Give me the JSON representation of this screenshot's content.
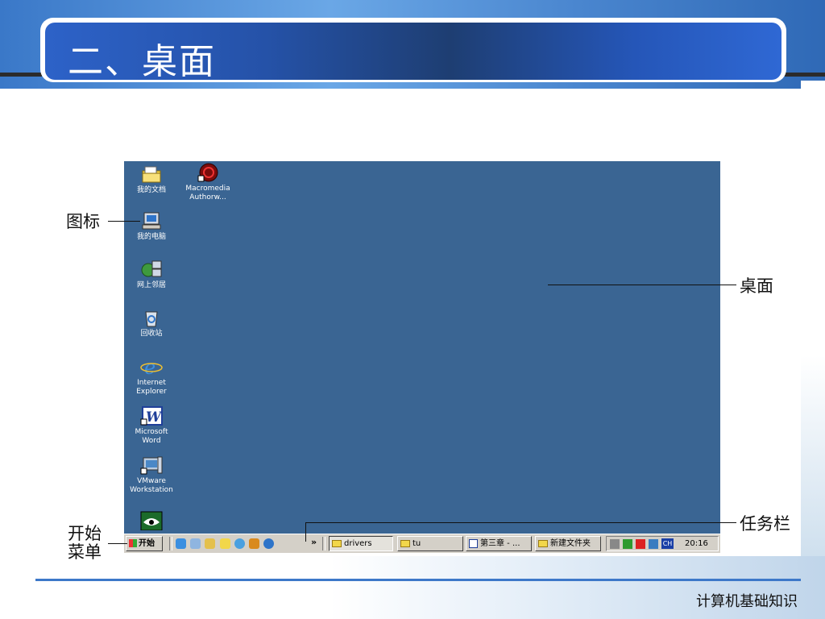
{
  "slide": {
    "title": "二、桌面",
    "footer": "计算机基础知识"
  },
  "annotations": {
    "icon_label": "图标",
    "desktop_label": "桌面",
    "taskbar_label": "任务栏",
    "start_menu_label_line1": "开始",
    "start_menu_label_line2": "菜单"
  },
  "desktop": {
    "icons": [
      {
        "label_line1": "我的文档",
        "label_line2": "",
        "icon": "my-documents-icon"
      },
      {
        "label_line1": "Macromedia",
        "label_line2": "Authorw...",
        "icon": "macromedia-authorware-icon"
      },
      {
        "label_line1": "我的电脑",
        "label_line2": "",
        "icon": "my-computer-icon"
      },
      {
        "label_line1": "网上邻居",
        "label_line2": "",
        "icon": "network-places-icon"
      },
      {
        "label_line1": "回收站",
        "label_line2": "",
        "icon": "recycle-bin-icon"
      },
      {
        "label_line1": "Internet",
        "label_line2": "Explorer",
        "icon": "internet-explorer-icon"
      },
      {
        "label_line1": "Microsoft",
        "label_line2": "Word",
        "icon": "word-icon"
      },
      {
        "label_line1": "VMware",
        "label_line2": "Workstation",
        "icon": "vmware-icon"
      },
      {
        "label_line1": "",
        "label_line2": "",
        "icon": "partial-app-icon"
      }
    ]
  },
  "taskbar": {
    "start_label": "开始",
    "chevron": "»",
    "windows": [
      {
        "label": "drivers",
        "icon": "folder-icon"
      },
      {
        "label": "tu",
        "icon": "folder-icon"
      },
      {
        "label": "第三章 - ...",
        "icon": "word-doc-icon"
      },
      {
        "label": "新建文件夹",
        "icon": "folder-icon"
      }
    ],
    "tray": {
      "language": "CH",
      "clock": "20:16"
    }
  },
  "colors": {
    "desktop": "#3a6593",
    "title_bar": "#2552a8",
    "taskbar": "#d4d0c8"
  }
}
